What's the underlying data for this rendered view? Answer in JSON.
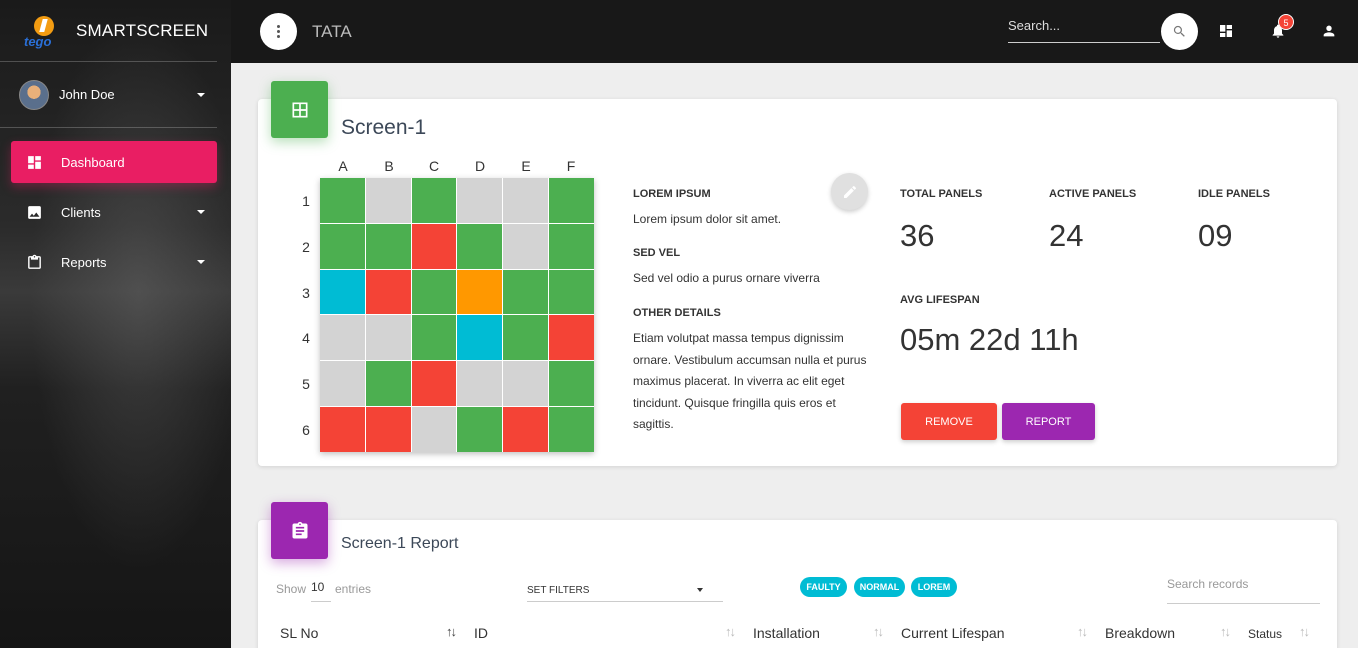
{
  "app": {
    "brand": "SMARTSCREEN",
    "logo_text": "tego"
  },
  "user": {
    "name": "John Doe"
  },
  "sidebar": {
    "items": [
      {
        "label": "Dashboard",
        "icon": "dashboard-icon",
        "active": true
      },
      {
        "label": "Clients",
        "icon": "image-icon",
        "active": false
      },
      {
        "label": "Reports",
        "icon": "clipboard-icon",
        "active": false
      }
    ]
  },
  "topbar": {
    "title": "TATA",
    "search_placeholder": "Search...",
    "notifications_count": "5"
  },
  "screen": {
    "title": "Screen-1",
    "columns": [
      "A",
      "B",
      "C",
      "D",
      "E",
      "F"
    ],
    "rows": [
      "1",
      "2",
      "3",
      "4",
      "5",
      "6"
    ],
    "cell_colors": {
      "green": "#4caf50",
      "grey": "#d3d3d3",
      "red": "#f44336",
      "cyan": "#00bcd4",
      "orange": "#ff9800"
    },
    "cells": [
      [
        "green",
        "grey",
        "green",
        "grey",
        "grey",
        "green"
      ],
      [
        "green",
        "green",
        "red",
        "green",
        "grey",
        "green"
      ],
      [
        "cyan",
        "red",
        "green",
        "orange",
        "green",
        "green"
      ],
      [
        "grey",
        "grey",
        "green",
        "cyan",
        "green",
        "red"
      ],
      [
        "grey",
        "green",
        "red",
        "grey",
        "grey",
        "green"
      ],
      [
        "red",
        "red",
        "grey",
        "green",
        "red",
        "green"
      ]
    ],
    "details": {
      "h1": "LOREM IPSUM",
      "t1": "Lorem ipsum dolor sit amet.",
      "h2": "SED VEL",
      "t2": "Sed vel odio a purus ornare viverra",
      "h3": "OTHER DETAILS",
      "t3": "Etiam volutpat massa tempus dignissim ornare. Vestibulum accumsan nulla et purus maximus placerat. In viverra ac elit eget tincidunt. Quisque fringilla quis eros et sagittis."
    },
    "stats": {
      "total_label": "TOTAL PANELS",
      "total_value": "36",
      "active_label": "ACTIVE PANELS",
      "active_value": "24",
      "idle_label": "IDLE PANELS",
      "idle_value": "09",
      "lifespan_label": "AVG LIFESPAN",
      "lifespan_value": "05m 22d 11h"
    },
    "buttons": {
      "remove": "REMOVE",
      "report": "REPORT"
    }
  },
  "report": {
    "title": "Screen-1 Report",
    "show_label": "Show",
    "show_value": "10",
    "entries_label": "entries",
    "filters_label": "SET FILTERS",
    "chips": [
      "FAULTY",
      "NORMAL",
      "LOREM"
    ],
    "search_placeholder": "Search records",
    "columns": [
      "SL No",
      "ID",
      "Installation",
      "Current Lifespan",
      "Breakdown",
      "Status"
    ]
  }
}
